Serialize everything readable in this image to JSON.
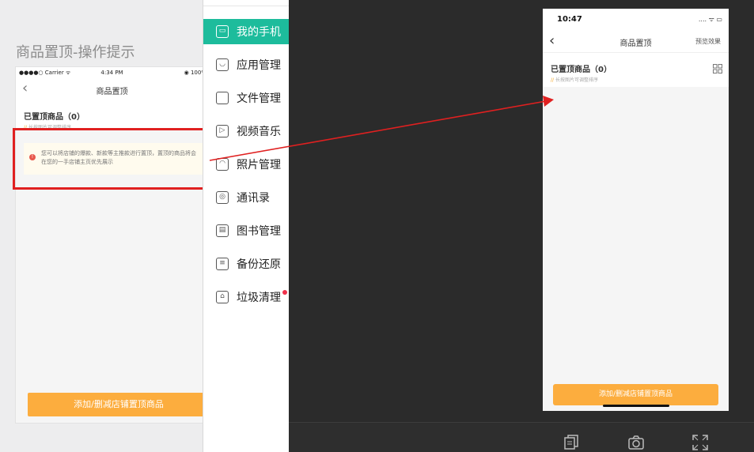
{
  "design": {
    "title": "商品置顶-操作提示",
    "mock": {
      "status_left": "●●●●○ Carrier ᯤ",
      "status_time": "4:34 PM",
      "status_right": "◉ 100%",
      "back": "‹",
      "nav_title": "商品置顶",
      "section_title": "已置顶商品（0）",
      "section_hint_mark": "//",
      "section_hint": "长按图片可调整排序",
      "notice_icon": "!",
      "notice_text": "您可以将店铺的爆款、新款等主推款进行置顶，置顶的商品将会在您的一手店铺主页优先展示",
      "button_label": "添加/删减店铺置顶商品"
    }
  },
  "sidebar": {
    "items": [
      {
        "label": "我的手机",
        "icon": "phone-icon",
        "glyph": "▭"
      },
      {
        "label": "应用管理",
        "icon": "bag-icon",
        "glyph": "◡"
      },
      {
        "label": "文件管理",
        "icon": "folder-icon",
        "glyph": ""
      },
      {
        "label": "视频音乐",
        "icon": "play-icon",
        "glyph": "▷"
      },
      {
        "label": "照片管理",
        "icon": "image-icon",
        "glyph": "◠"
      },
      {
        "label": "通讯录",
        "icon": "contacts-icon",
        "glyph": "◎"
      },
      {
        "label": "图书管理",
        "icon": "book-icon",
        "glyph": "▤"
      },
      {
        "label": "备份还原",
        "icon": "backup-icon",
        "glyph": "≡"
      },
      {
        "label": "垃圾清理",
        "icon": "broom-icon",
        "glyph": "⌂"
      }
    ]
  },
  "preview": {
    "status_time": "10:47",
    "status_icons": ".... ᯤ ▭",
    "back": "‹",
    "nav_title": "商品置顶",
    "preview_label": "预览效果",
    "section_title": "已置顶商品（0）",
    "section_hint_mark": "//",
    "section_hint": "长按图片可调整排序",
    "button_label": "添加/删减店铺置顶商品"
  },
  "colors": {
    "accent_green": "#1dbc9c",
    "orange_button": "#fcad3e",
    "red_highlight": "#e02020",
    "dark_bg": "#2b2b2b"
  }
}
